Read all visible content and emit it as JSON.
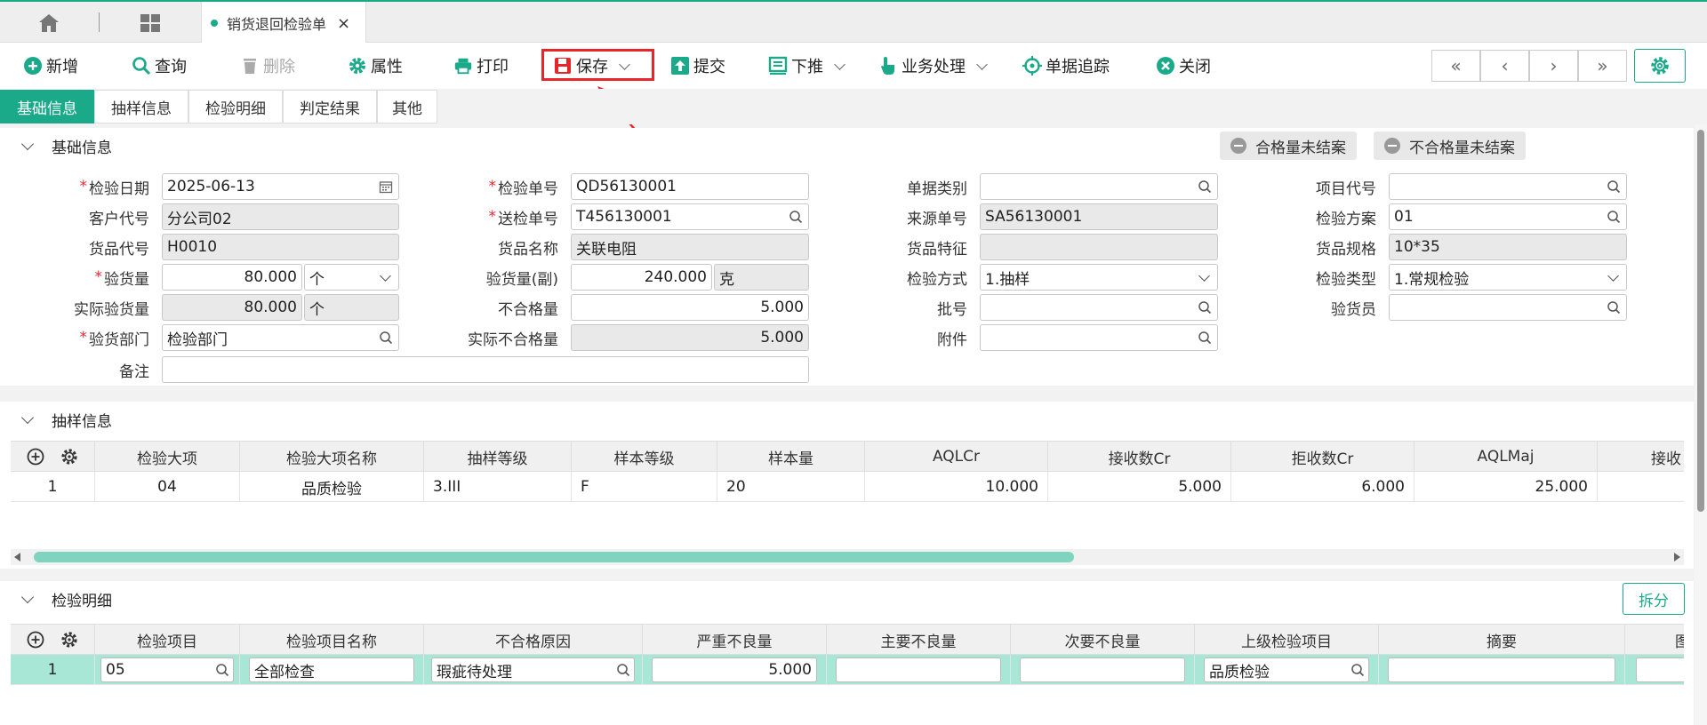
{
  "tabbar": {
    "doc_tab_title": "销货退回检验单",
    "close_glyph": "×"
  },
  "toolbar": {
    "new": "新增",
    "query": "查询",
    "delete": "删除",
    "props": "属性",
    "print": "打印",
    "save": "保存",
    "submit": "提交",
    "push_down": "下推",
    "business": "业务处理",
    "trace": "单据追踪",
    "close": "关闭"
  },
  "nav": {
    "first": "«",
    "prev": "‹",
    "next": "›",
    "last": "»"
  },
  "subtabs": [
    "基础信息",
    "抽样信息",
    "检验明细",
    "判定结果",
    "其他"
  ],
  "basic": {
    "title": "基础信息",
    "pill_ok": "合格量未结案",
    "pill_ng": "不合格量未结案",
    "labels": {
      "insp_date": "检验日期",
      "insp_no": "检验单号",
      "doc_type": "单据类别",
      "proj_code": "项目代号",
      "cust_code": "客户代号",
      "send_no": "送检单号",
      "src_no": "来源单号",
      "insp_plan": "检验方案",
      "item_code": "货品代号",
      "item_name": "货品名称",
      "item_feat": "货品特征",
      "item_spec": "货品规格",
      "insp_qty": "验货量",
      "insp_qty2": "验货量(副)",
      "insp_mode": "检验方式",
      "insp_type": "检验类型",
      "act_qty": "实际验货量",
      "ng_qty": "不合格量",
      "batch": "批号",
      "inspector": "验货员",
      "dept": "验货部门",
      "act_ng_qty": "实际不合格量",
      "attach": "附件",
      "remark": "备注"
    },
    "values": {
      "insp_date": "2025-06-13",
      "insp_no": "QD56130001",
      "doc_type": "",
      "proj_code": "",
      "cust_code": "分公司02",
      "send_no": "T456130001",
      "src_no": "SA56130001",
      "insp_plan": "01",
      "item_code": "H0010",
      "item_name": "关联电阻",
      "item_feat": "",
      "item_spec": "10*35",
      "insp_qty": "80.000",
      "insp_qty_unit": "个",
      "insp_qty2": "240.000",
      "insp_qty2_unit": "克",
      "insp_mode": "1.抽样",
      "insp_type": "1.常规检验",
      "act_qty": "80.000",
      "act_qty_unit": "个",
      "ng_qty": "5.000",
      "batch": "",
      "inspector": "",
      "dept": "检验部门",
      "act_ng_qty": "5.000",
      "attach": "",
      "remark": ""
    }
  },
  "sampling": {
    "title": "抽样信息",
    "headers": [
      "检验大项",
      "检验大项名称",
      "抽样等级",
      "样本等级",
      "样本量",
      "AQLCr",
      "接收数Cr",
      "拒收数Cr",
      "AQLMaj",
      "接收"
    ],
    "rows": [
      {
        "idx": "1",
        "cells": [
          "04",
          "品质检验",
          "3.III",
          "F",
          "20",
          "10.000",
          "5.000",
          "6.000",
          "25.000",
          ""
        ]
      }
    ]
  },
  "detail": {
    "title": "检验明细",
    "split": "拆分",
    "headers": [
      "检验项目",
      "检验项目名称",
      "不合格原因",
      "严重不良量",
      "主要不良量",
      "次要不良量",
      "上级检验项目",
      "摘要",
      "图"
    ],
    "rows": [
      {
        "idx": "1",
        "cells": [
          "05",
          "全部检查",
          "瑕疵待处理",
          "5.000",
          "",
          "",
          "品质检验",
          "",
          ""
        ]
      }
    ]
  },
  "colors": {
    "accent": "#1aaa8a",
    "highlight": "#e8262a",
    "selected_row": "#a8e6d6"
  }
}
